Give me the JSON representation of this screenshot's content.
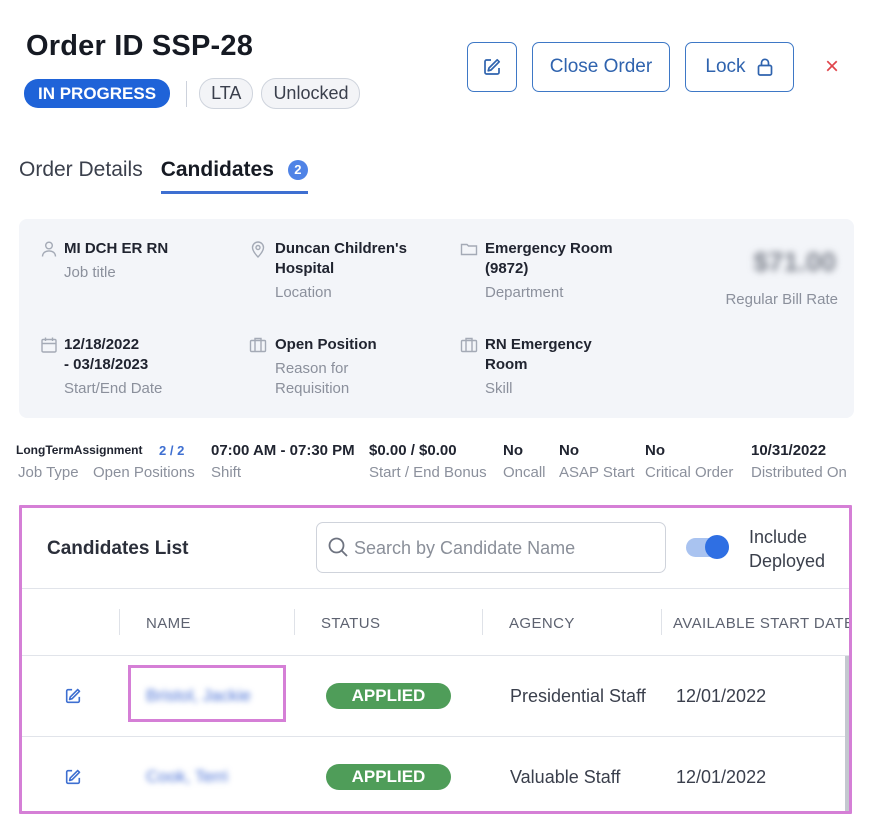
{
  "header": {
    "title": "Order ID SSP-28",
    "status_badge": "IN PROGRESS",
    "type_badge": "LTA",
    "lock_badge": "Unlocked",
    "close_order_label": "Close Order",
    "lock_label": "Lock",
    "close_symbol": "×"
  },
  "tabs": {
    "order_details": "Order Details",
    "candidates": "Candidates",
    "candidates_count": "2"
  },
  "details": {
    "job_title": "MI DCH ER RN",
    "job_title_label": "Job title",
    "location_line1": "Duncan Children's",
    "location_line2": "Hospital",
    "location_label": "Location",
    "department_line1": "Emergency Room",
    "department_line2": "(9872)",
    "department_label": "Department",
    "bill_rate": "$71.00",
    "bill_rate_label": "Regular Bill Rate",
    "date_line1": "12/18/2022",
    "date_line2": "- 03/18/2023",
    "date_label": "Start/End Date",
    "reason": "Open Position",
    "reason_label_line1": "Reason for",
    "reason_label_line2": "Requisition",
    "skill_line1": "RN Emergency",
    "skill_line2": "Room",
    "skill_label": "Skill"
  },
  "meta": {
    "job_type": "LongTermAssignment",
    "job_type_label": "Job Type",
    "open_positions": "2 / 2",
    "open_positions_label": "Open Positions",
    "shift": "07:00 AM - 07:30 PM",
    "shift_label": "Shift",
    "bonus": "$0.00 / $0.00",
    "bonus_label": "Start / End Bonus",
    "oncall": "No",
    "oncall_label": "Oncall",
    "asap": "No",
    "asap_label": "ASAP Start",
    "critical": "No",
    "critical_label": "Critical Order",
    "distributed": "10/31/2022",
    "distributed_label": "Distributed On"
  },
  "candidates_list": {
    "title": "Candidates List",
    "search_placeholder": "Search by Candidate Name",
    "toggle_label_line1": "Include",
    "toggle_label_line2": "Deployed",
    "toggle_on": true,
    "columns": [
      "NAME",
      "STATUS",
      "AGENCY",
      "AVAILABLE START DATE"
    ],
    "rows": [
      {
        "name": "Bristol, Jackie",
        "status": "APPLIED",
        "agency": "Presidential Staff",
        "start_date": "12/01/2022"
      },
      {
        "name": "Cook, Terri",
        "status": "APPLIED",
        "agency": "Valuable Staff",
        "start_date": "12/01/2022"
      }
    ]
  },
  "colors": {
    "accent": "#1f63d8",
    "button_border": "#3e78c6",
    "status_applied": "#4f9d59",
    "close_red": "#e0454b",
    "highlight": "#d57fd6"
  }
}
